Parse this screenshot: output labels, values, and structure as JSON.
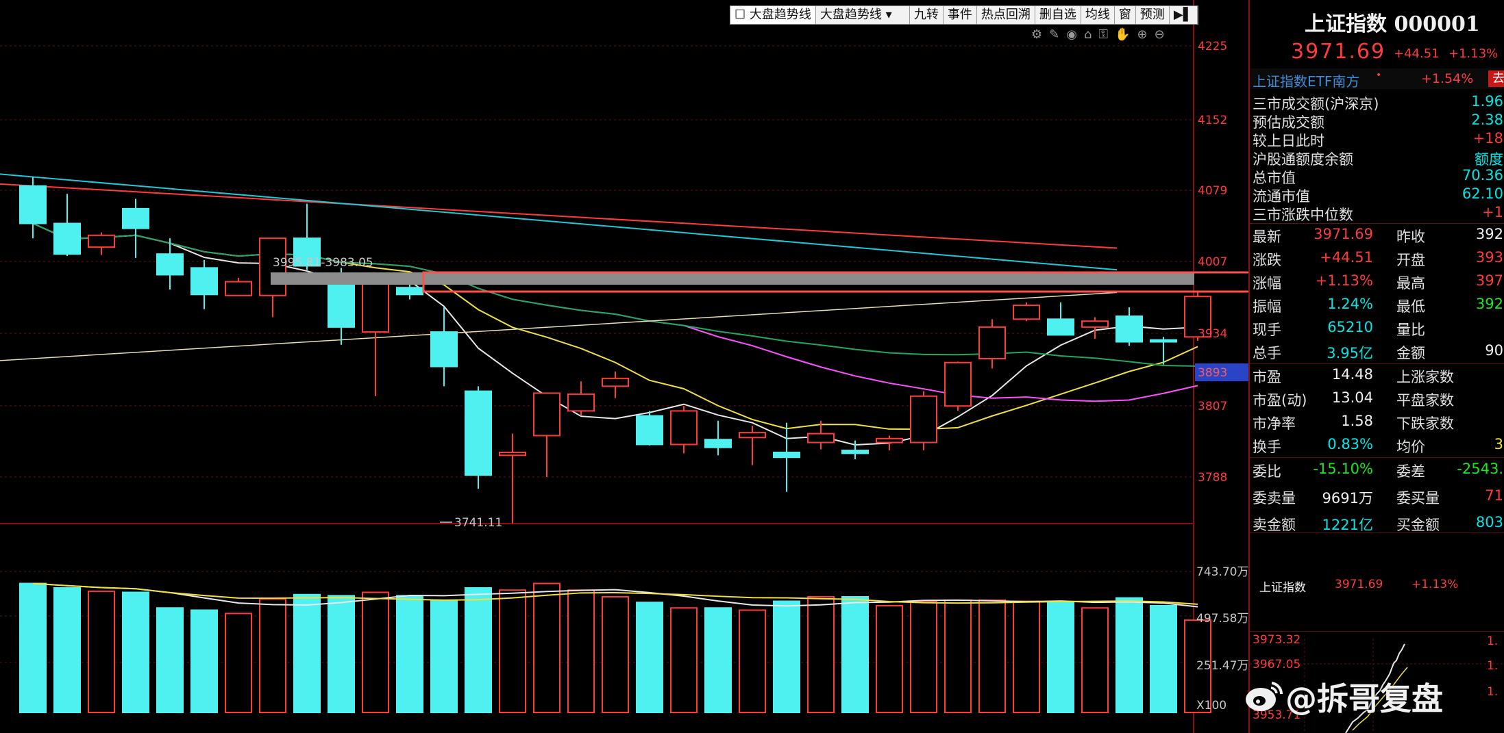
{
  "toolbar": {
    "checkbox_label": "大盘趋势线",
    "dropdown_value": "大盘趋势线",
    "buttons": [
      "九转",
      "事件",
      "热点回溯",
      "删自选",
      "均线",
      "窗",
      "预测"
    ]
  },
  "toolbar_icons": [
    "gear-icon",
    "pen-icon",
    "eye-icon",
    "basket-icon",
    "lock-icon",
    "hand-icon",
    "zoom-in-icon",
    "zoom-out-icon"
  ],
  "price_axis": {
    "labels": [
      "4225",
      "4152",
      "4079",
      "4007",
      "3934",
      "3893",
      "3807",
      "3788"
    ],
    "current_label": "3893"
  },
  "volume_axis": {
    "labels": [
      "743.70万",
      "497.58万",
      "251.47万"
    ],
    "multiplier": "X100"
  },
  "annotations": {
    "range_label": "3995.81-3983.05",
    "low_label": "3741.11"
  },
  "colors": {
    "up": "#ff3c3c",
    "down": "#4ff0f0",
    "axis_red": "#8b1010",
    "highlight_box": "#ff5050"
  },
  "chart_data": {
    "type": "candlestick",
    "ylim": [
      3700,
      4260
    ],
    "candles": [
      {
        "o": 4083,
        "h": 4092,
        "l": 4030,
        "c": 4045
      },
      {
        "o": 4045,
        "h": 4075,
        "l": 4012,
        "c": 4014
      },
      {
        "o": 4021,
        "h": 4036,
        "l": 4013,
        "c": 4033
      },
      {
        "o": 4060,
        "h": 4070,
        "l": 4010,
        "c": 4040
      },
      {
        "o": 4014,
        "h": 4030,
        "l": 3978,
        "c": 3993
      },
      {
        "o": 4000,
        "h": 4008,
        "l": 3958,
        "c": 3973
      },
      {
        "o": 3972,
        "h": 3990,
        "l": 3976,
        "c": 3986
      },
      {
        "o": 3972,
        "h": 4022,
        "l": 3950,
        "c": 4030
      },
      {
        "o": 4030,
        "h": 4065,
        "l": 3998,
        "c": 4002
      },
      {
        "o": 3990,
        "h": 4000,
        "l": 3922,
        "c": 3940
      },
      {
        "o": 3935,
        "h": 3990,
        "l": 3870,
        "c": 3990
      },
      {
        "o": 3980,
        "h": 3995,
        "l": 3968,
        "c": 3973
      },
      {
        "o": 3935,
        "h": 3960,
        "l": 3880,
        "c": 3900
      },
      {
        "o": 3875,
        "h": 3880,
        "l": 3776,
        "c": 3790
      },
      {
        "o": 3810,
        "h": 3832,
        "l": 3741,
        "c": 3813
      },
      {
        "o": 3830,
        "h": 3872,
        "l": 3788,
        "c": 3873
      },
      {
        "o": 3855,
        "h": 3885,
        "l": 3850,
        "c": 3872
      },
      {
        "o": 3880,
        "h": 3895,
        "l": 3868,
        "c": 3888
      },
      {
        "o": 3850,
        "h": 3855,
        "l": 3820,
        "c": 3821
      },
      {
        "o": 3821,
        "h": 3860,
        "l": 3812,
        "c": 3855
      },
      {
        "o": 3826,
        "h": 3845,
        "l": 3810,
        "c": 3818
      },
      {
        "o": 3828,
        "h": 3840,
        "l": 3800,
        "c": 3833
      },
      {
        "o": 3813,
        "h": 3843,
        "l": 3773,
        "c": 3808
      },
      {
        "o": 3823,
        "h": 3845,
        "l": 3816,
        "c": 3832
      },
      {
        "o": 3815,
        "h": 3825,
        "l": 3806,
        "c": 3812
      },
      {
        "o": 3823,
        "h": 3830,
        "l": 3815,
        "c": 3827
      },
      {
        "o": 3823,
        "h": 3875,
        "l": 3815,
        "c": 3870
      },
      {
        "o": 3860,
        "h": 3905,
        "l": 3855,
        "c": 3904
      },
      {
        "o": 3908,
        "h": 3948,
        "l": 3898,
        "c": 3940
      },
      {
        "o": 3948,
        "h": 3965,
        "l": 3946,
        "c": 3962
      },
      {
        "o": 3948,
        "h": 3965,
        "l": 3932,
        "c": 3932
      },
      {
        "o": 3940,
        "h": 3950,
        "l": 3928,
        "c": 3946
      },
      {
        "o": 3951,
        "h": 3960,
        "l": 3921,
        "c": 3925
      },
      {
        "o": 3927,
        "h": 3930,
        "l": 3902,
        "c": 3925
      },
      {
        "o": 3930,
        "h": 3975,
        "l": 3926,
        "c": 3971
      }
    ],
    "volumes": [
      580,
      560,
      545,
      540,
      470,
      460,
      445,
      510,
      530,
      525,
      540,
      525,
      505,
      560,
      550,
      580,
      550,
      520,
      495,
      470,
      470,
      460,
      500,
      520,
      520,
      480,
      500,
      505,
      505,
      500,
      495,
      470,
      515,
      480,
      415
    ]
  },
  "panel": {
    "title": "上证指数 000001",
    "price": "3971.69",
    "change": "+44.51",
    "change_pct": "+1.13%",
    "etf_name": "上证指数ETF南方",
    "etf_dot": "•",
    "etf_pct": "+1.54%",
    "etf_btn": "去",
    "stats": [
      {
        "label": "三市成交额(沪深京)",
        "value": "1.96"
      },
      {
        "label": "预估成交额",
        "value": "2.38"
      },
      {
        "label": "较上日此时",
        "value": "+18"
      },
      {
        "label": "沪股通额度余额",
        "value": "额度"
      },
      {
        "label": "总市值",
        "value": "70.36"
      },
      {
        "label": "流通市值",
        "value": "62.10"
      },
      {
        "label": "三市涨跌中位数",
        "value": "+1"
      }
    ],
    "grid": [
      {
        "l1": "最新",
        "v1": "3971.69",
        "l2": "昨收",
        "v2": "392"
      },
      {
        "l1": "涨跌",
        "v1": "+44.51",
        "l2": "开盘",
        "v2": "393"
      },
      {
        "l1": "涨幅",
        "v1": "+1.13%",
        "l2": "最高",
        "v2": "397"
      },
      {
        "l1": "振幅",
        "v1": "1.24%",
        "l2": "最低",
        "v2": "392"
      },
      {
        "l1": "现手",
        "v1": "65210",
        "l2": "量比",
        "v2": ""
      },
      {
        "l1": "总手",
        "v1": "3.95亿",
        "l2": "金额",
        "v2": "90"
      },
      {
        "l1": "市盈",
        "v1": "14.48",
        "l2": "上涨家数",
        "v2": ""
      },
      {
        "l1": "市盈(动)",
        "v1": "13.04",
        "l2": "平盘家数",
        "v2": ""
      },
      {
        "l1": "市净率",
        "v1": "1.58",
        "l2": "下跌家数",
        "v2": ""
      },
      {
        "l1": "换手",
        "v1": "0.83%",
        "l2": "均价",
        "v2": "3"
      },
      {
        "l1": "委比",
        "v1": "-15.10%",
        "l2": "委差",
        "v2": "-2543."
      },
      {
        "l1": "委卖量",
        "v1": "9691万",
        "l2": "委买量",
        "v2": "71"
      },
      {
        "l1": "卖金额",
        "v1": "1221亿",
        "l2": "买金额",
        "v2": "803"
      }
    ],
    "mini_name": "上证指数",
    "mini_price": "3971.69",
    "mini_pct": "+1.13%",
    "mini_axis": [
      "3973.32",
      "3967.05",
      "3953.71"
    ],
    "mini_right": [
      "1.",
      "1.",
      "1."
    ]
  },
  "watermark": "@拆哥复盘"
}
